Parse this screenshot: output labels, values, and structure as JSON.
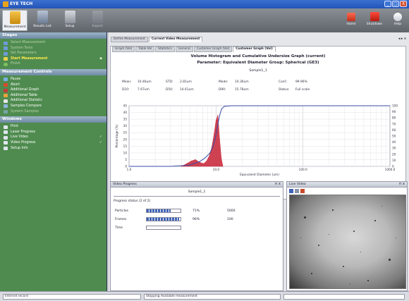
{
  "app": {
    "title": "EYE TECH",
    "window_buttons": [
      "_",
      "□",
      "X"
    ]
  },
  "toolbar": {
    "left_buttons": [
      {
        "label": "Measurement",
        "icon": "measurement-icon"
      },
      {
        "label": "Results List",
        "icon": "results-list-icon"
      },
      {
        "label": "Setup",
        "icon": "setup-icon"
      },
      {
        "label": "Export",
        "icon": "export-icon"
      }
    ],
    "right_buttons": [
      {
        "label": "Home",
        "icon": "home-icon"
      },
      {
        "label": "Shutdown",
        "icon": "shutdown-icon"
      },
      {
        "label": "Help",
        "icon": "help-icon"
      }
    ]
  },
  "sidebar": {
    "stages": {
      "header": "Stages",
      "items": [
        {
          "label": "Select Measurement",
          "state": "faint"
        },
        {
          "label": "System Tests",
          "state": "faint"
        },
        {
          "label": "Set Parameters",
          "state": "faint"
        },
        {
          "label": "Start Measurement",
          "state": "active"
        },
        {
          "label": "Finish",
          "state": "faint"
        }
      ]
    },
    "controls": {
      "header": "Measurement Controls",
      "items": [
        "Pause",
        "Abort",
        "Additional Graph",
        "Additional Table",
        "Additional Statistic",
        "Samples Compare",
        "System Samples"
      ]
    },
    "windows": {
      "header": "Windows",
      "items": [
        "Print",
        "Laser Progress",
        "Live Video",
        "Video Progress",
        "Setup Info"
      ]
    }
  },
  "content": {
    "main_tabs": [
      "Define Measurement",
      "Current Video Measurement"
    ],
    "sub_tabs": [
      "Graph (Vol)",
      "Table Vol",
      "Statistics",
      "General",
      "Customer Graph (Vol)",
      "Customer Graph (Vol)"
    ],
    "nav_arrows": "◂ ▸ x",
    "graph": {
      "title": "Volume Histogram and Cumulative Undersize Graph (current)",
      "subtitle": "Parameter:  Equivalent Diameter   Group:  Spherical (GE3)",
      "sample_name": "Sample1_1",
      "stats": [
        {
          "label": "Mean:",
          "value": "10.46um"
        },
        {
          "label": "STD:",
          "value": "2.81um"
        },
        {
          "label": "Mode:",
          "value": "10.36um"
        },
        {
          "label": "Conf.:",
          "value": "99.96%"
        },
        {
          "label": "D10:",
          "value": "7.67um"
        },
        {
          "label": "D50:",
          "value": "14.61um"
        },
        {
          "label": "D90:",
          "value": "15.78um"
        },
        {
          "label": "Status:",
          "value": "Full scale"
        }
      ]
    }
  },
  "chart_data": {
    "type": "area",
    "x_scale": "log",
    "xlim": [
      1,
      1000
    ],
    "x_ticks": [
      "1.0",
      "10.0",
      "100.0",
      "1000.0"
    ],
    "xlabel": "Equivalent Diameter (um)",
    "ylabel_left": "Percentage (%)",
    "ylim_left": [
      0,
      45
    ],
    "y_ticks_left": [
      0,
      5,
      10,
      15,
      20,
      25,
      30,
      35,
      40,
      45
    ],
    "ylim_right": [
      0,
      100
    ],
    "y_ticks_right": [
      0,
      10,
      20,
      30,
      40,
      50,
      60,
      70,
      80,
      90,
      100
    ],
    "grid": true,
    "series": [
      {
        "kind": "histogram",
        "color": "#c8283a",
        "x": [
          4.0,
          4.6,
          5.2,
          5.8,
          6.5,
          7.2,
          7.8,
          8.4,
          9.0,
          9.5,
          10.0,
          10.5,
          11.0,
          11.5,
          12.0
        ],
        "y": [
          0,
          2,
          4,
          5,
          3,
          2,
          4,
          8,
          15,
          24,
          34,
          38,
          20,
          6,
          0
        ]
      },
      {
        "kind": "cumulative",
        "color": "#3a4ea8",
        "x": [
          1.0,
          3.0,
          5.0,
          6.5,
          7.5,
          8.5,
          9.2,
          9.8,
          10.4,
          11.0,
          11.6,
          12.5,
          15.0,
          30.0,
          100.0,
          300.0,
          1000.0
        ],
        "y": [
          0,
          0,
          2,
          8,
          14,
          22,
          32,
          46,
          66,
          84,
          95,
          99,
          100,
          100,
          100,
          100,
          100
        ]
      }
    ]
  },
  "progress_panel": {
    "title": "Video Progress",
    "sample": "Sample1_1",
    "status_label": "Progress status (2 of 2)",
    "rows": [
      {
        "label": "Particles",
        "fraction": 0.71,
        "percent": "71%",
        "count": "5000"
      },
      {
        "label": "Frames",
        "fraction": 0.96,
        "percent": "96%",
        "count": "100"
      },
      {
        "label": "Time",
        "fraction": 0,
        "percent": "",
        "count": ""
      }
    ]
  },
  "live_panel": {
    "title": "Live Video"
  },
  "statusbar": {
    "cells": [
      "Internet record",
      "Stopping Available measurement",
      ""
    ]
  },
  "colors": {
    "sidebar": "#4f8b4f",
    "panel_header": "#6e8aa3",
    "active_stage": "#ffe94a",
    "histogram": "#c8283a",
    "cumulative": "#3a4ea8"
  }
}
